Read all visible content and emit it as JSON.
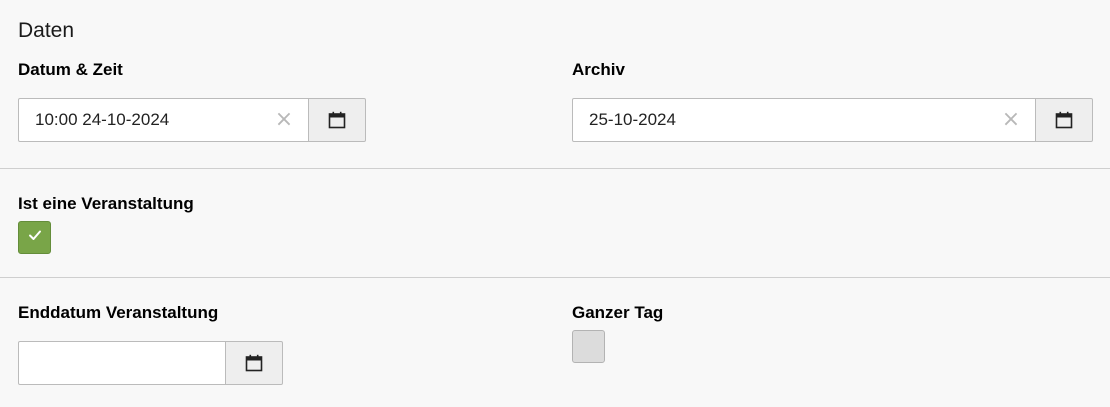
{
  "section": {
    "legend": "Daten"
  },
  "datetime": {
    "label": "Datum & Zeit",
    "value": "10:00 24-10-2024",
    "clear_icon": "close-icon",
    "calendar_icon": "calendar-icon"
  },
  "archive": {
    "label": "Archiv",
    "value": "25-10-2024",
    "clear_icon": "close-icon",
    "calendar_icon": "calendar-icon"
  },
  "is_event": {
    "label": "Ist eine Veranstaltung",
    "checked": true,
    "check_icon": "check-icon"
  },
  "event_end": {
    "label": "Enddatum Veranstaltung",
    "value": "",
    "calendar_icon": "calendar-icon"
  },
  "full_day": {
    "label": "Ganzer Tag",
    "checked": false
  },
  "colors": {
    "checkbox_checked": "#79a548",
    "checkbox_unchecked": "#dcdcdc",
    "background": "#f8f8f8"
  }
}
